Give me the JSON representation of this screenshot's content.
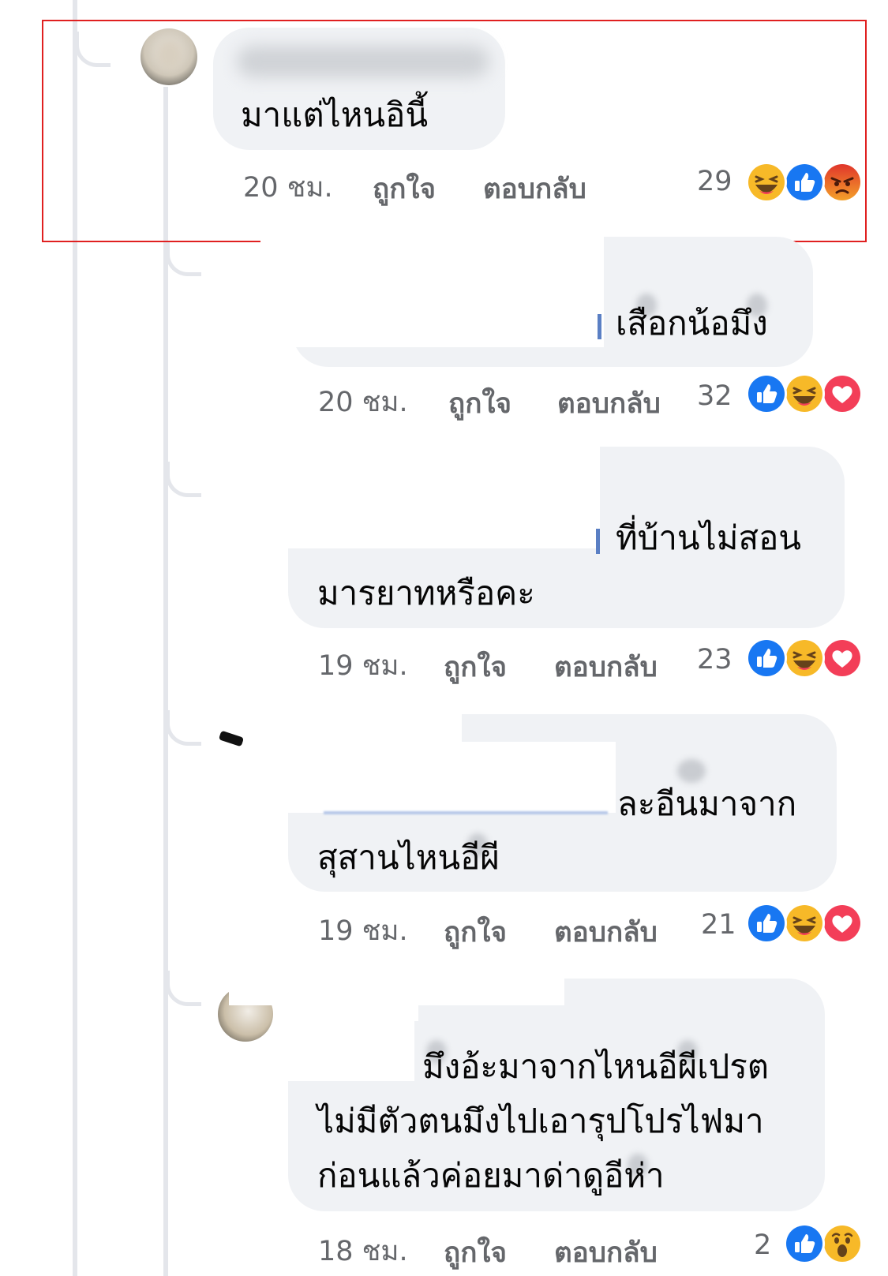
{
  "comments": [
    {
      "text_lines": [
        "มาแต่ไหนอินี้"
      ],
      "time": "20 ชม.",
      "like_label": "ถูกใจ",
      "reply_label": "ตอบกลับ",
      "reaction_count": "29",
      "reactions": [
        "haha",
        "like",
        "angry"
      ]
    },
    {
      "text_lines": [
        "เสือกน้อมึง"
      ],
      "time": "20 ชม.",
      "like_label": "ถูกใจ",
      "reply_label": "ตอบกลับ",
      "reaction_count": "32",
      "reactions": [
        "like",
        "haha",
        "love"
      ]
    },
    {
      "text_lines": [
        "ที่บ้านไม่สอน",
        "มารยาทหรือคะ"
      ],
      "time": "19 ชม.",
      "like_label": "ถูกใจ",
      "reply_label": "ตอบกลับ",
      "reaction_count": "23",
      "reactions": [
        "like",
        "haha",
        "love"
      ]
    },
    {
      "text_lines": [
        "ละอีนมาจาก",
        "สุสานไหนอีผี"
      ],
      "time": "19 ชม.",
      "like_label": "ถูกใจ",
      "reply_label": "ตอบกลับ",
      "reaction_count": "21",
      "reactions": [
        "like",
        "haha",
        "love"
      ]
    },
    {
      "text_lines": [
        "มึงอ้ะมาจากไหนอีผีเปรต",
        "ไม่มีตัวตนมึงไปเอารุปโปรไฟมา",
        "ก่อนแล้วค่อยมาด่าดูอีห่า"
      ],
      "time": "18 ชม.",
      "like_label": "ถูกใจ",
      "reply_label": "ตอบกลับ",
      "reaction_count": "2",
      "reactions": [
        "like",
        "wow"
      ]
    }
  ],
  "colors": {
    "bubble": "#f0f2f5",
    "meta_text": "#65676b",
    "thread_line": "#e4e6eb",
    "highlight_border": "#e02020",
    "like_blue": "#1877f2",
    "haha_yellow": "#f7b928",
    "love_red": "#f33e58",
    "angry_orange": "#e9710f"
  }
}
